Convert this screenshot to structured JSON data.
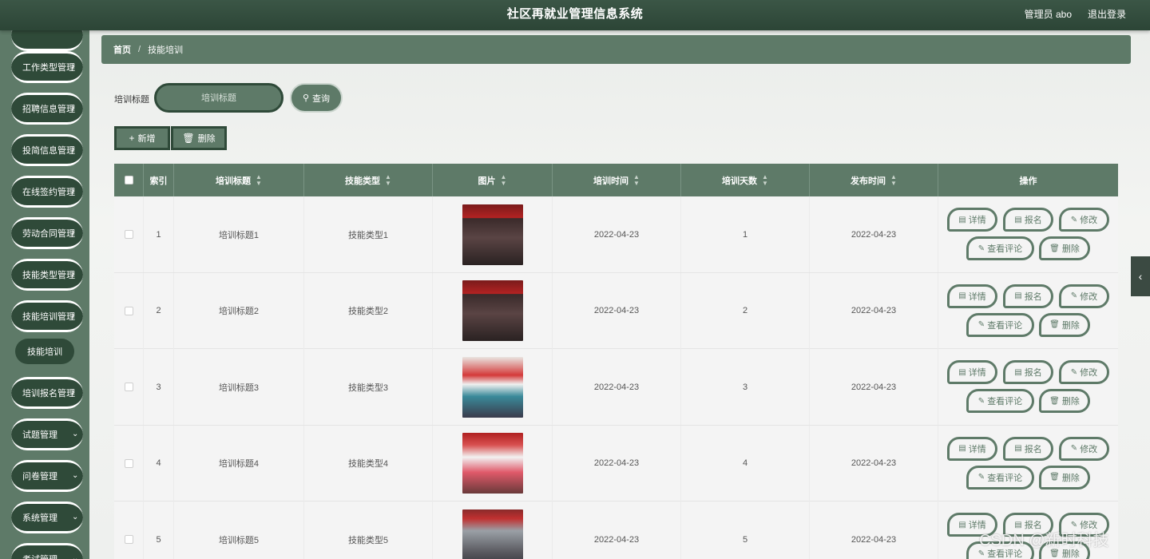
{
  "header": {
    "title": "社区再就业管理信息系统",
    "user": "管理员 abo",
    "logout": "退出登录"
  },
  "sidebar": {
    "items": [
      {
        "label": "工作类型管理"
      },
      {
        "label": "招聘信息管理"
      },
      {
        "label": "投简信息管理"
      },
      {
        "label": "在线签约管理"
      },
      {
        "label": "劳动合同管理"
      },
      {
        "label": "技能类型管理"
      },
      {
        "label": "技能培训管理"
      },
      {
        "label": "培训报名管理"
      },
      {
        "label": "试题管理"
      },
      {
        "label": "问卷管理"
      },
      {
        "label": "系统管理"
      },
      {
        "label": "考试管理"
      }
    ],
    "active_sub": "技能培训"
  },
  "breadcrumb": {
    "home": "首页",
    "sep": "/",
    "current": "技能培训"
  },
  "search": {
    "label": "培训标题",
    "placeholder": "培训标题",
    "button": "查询"
  },
  "actions": {
    "add": "新增",
    "delete": "删除"
  },
  "table": {
    "headers": {
      "index": "索引",
      "title": "培训标题",
      "type": "技能类型",
      "image": "图片",
      "time": "培训时间",
      "days": "培训天数",
      "publish": "发布时间",
      "ops": "操作"
    },
    "rows": [
      {
        "index": "1",
        "title": "培训标题1",
        "type": "技能类型1",
        "time": "2022-04-23",
        "days": "1",
        "publish": "2022-04-23"
      },
      {
        "index": "2",
        "title": "培训标题2",
        "type": "技能类型2",
        "time": "2022-04-23",
        "days": "2",
        "publish": "2022-04-23"
      },
      {
        "index": "3",
        "title": "培训标题3",
        "type": "技能类型3",
        "time": "2022-04-23",
        "days": "3",
        "publish": "2022-04-23"
      },
      {
        "index": "4",
        "title": "培训标题4",
        "type": "技能类型4",
        "time": "2022-04-23",
        "days": "4",
        "publish": "2022-04-23"
      },
      {
        "index": "5",
        "title": "培训标题5",
        "type": "技能类型5",
        "time": "2022-04-23",
        "days": "5",
        "publish": "2022-04-23"
      }
    ],
    "ops": {
      "detail": "详情",
      "signup": "报名",
      "edit": "修改",
      "comments": "查看评论",
      "delete": "删除"
    }
  },
  "watermark": "CSDN @新时科技",
  "colors": {
    "primary": "#5e7a68",
    "dark": "#2f4a39",
    "header": "#2c4536"
  }
}
